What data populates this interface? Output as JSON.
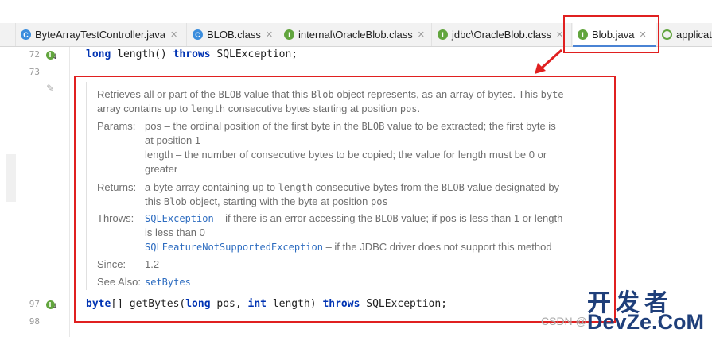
{
  "tabs": [
    {
      "label": "ByteArrayTestController.java",
      "icon": "class-icon",
      "badge": "C"
    },
    {
      "label": "BLOB.class",
      "icon": "class-icon",
      "badge": "C"
    },
    {
      "label": "internal\\OracleBlob.class",
      "icon": "interface-icon",
      "badge": "I"
    },
    {
      "label": "jdbc\\OracleBlob.class",
      "icon": "interface-icon",
      "badge": "I"
    },
    {
      "label": "Blob.java",
      "icon": "interface-icon",
      "badge": "I",
      "active": true
    },
    {
      "label": "applicat",
      "icon": "application-icon",
      "badge": ""
    }
  ],
  "gutter": {
    "lines": [
      "72",
      "73",
      "97",
      "98"
    ]
  },
  "code": {
    "line72": {
      "kw1": "long",
      "name": " length() ",
      "kw2": "throws",
      "rest": " SQLException;"
    },
    "line97": {
      "type": "byte",
      "a": "[] getBytes(",
      "kw1": "long",
      "b": " pos, ",
      "kw2": "int",
      "c": " length) ",
      "kw3": "throws",
      "d": " SQLException;"
    }
  },
  "doc": {
    "desc_1": "Retrieves all or part of the ",
    "desc_blob": "BLOB",
    "desc_2": " value that this ",
    "desc_blob2": "Blob",
    "desc_3": " object represents, as an array of bytes. This ",
    "desc_byte": "byte",
    "desc_4": "array contains up to ",
    "desc_length": "length",
    "desc_5": " consecutive bytes starting at position ",
    "desc_pos": "pos",
    "desc_6": ".",
    "params_label": "Params:",
    "param1_a": "pos – the ordinal position of the first byte in the ",
    "param1_blob": "BLOB",
    "param1_b": " value to be extracted; the first byte is",
    "param1_c": "at position 1",
    "param2_a": "length – the number of consecutive bytes to be copied; the value for length must be 0 or",
    "param2_b": "greater",
    "returns_label": "Returns:",
    "ret_a": "a byte array containing up to ",
    "ret_length": "length",
    "ret_b": " consecutive bytes from the ",
    "ret_blob": "BLOB",
    "ret_c": " value designated by",
    "ret_d": "this ",
    "ret_blob2": "Blob",
    "ret_e": " object, starting with the byte at position ",
    "ret_pos": "pos",
    "throws_label": "Throws:",
    "thr1_link": "SQLException",
    "thr1_a": " – if there is an error accessing the ",
    "thr1_blob": "BLOB",
    "thr1_b": " value; if pos is less than 1 or length",
    "thr1_c": "is less than 0",
    "thr2_link": "SQLFeatureNotSupportedException",
    "thr2_a": " – if the JDBC driver does not support this method",
    "since_label": "Since:",
    "since_value": "1.2",
    "seealso_label": "See Also:",
    "seealso_link": "setBytes"
  },
  "watermark": {
    "big": "开发者",
    "dev": "DevZe.CoM",
    "small": "CSDN @"
  },
  "colors": {
    "highlight": "#e02020",
    "keyword": "#0033b3",
    "link": "#2d6cc0",
    "active_tab_underline": "#4a83d4"
  }
}
